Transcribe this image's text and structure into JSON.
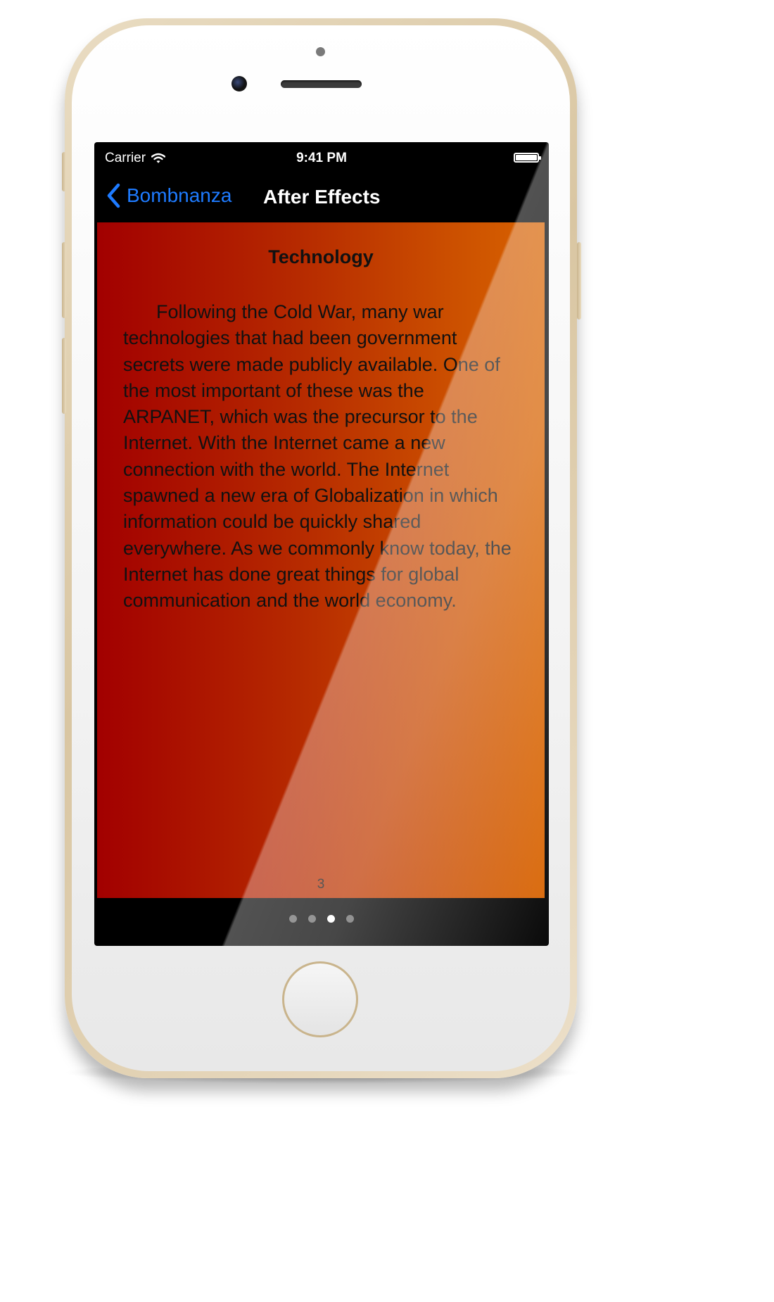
{
  "status_bar": {
    "carrier": "Carrier",
    "time": "9:41 PM",
    "wifi_icon": "wifi-icon",
    "battery_icon": "battery-icon"
  },
  "nav_bar": {
    "back_label": "Bombnanza",
    "back_icon": "chevron-left-icon",
    "title": "After Effects"
  },
  "page": {
    "heading": "Technology",
    "body": "Following the Cold War, many war technologies that had been government secrets were made publicly available. One of the most important of these was the ARPANET, which was the precursor to the Internet. With the Internet came a new connection with the world. The Internet spawned a new era of Globalization in which information could be quickly shared everywhere. As we commonly know today, the Internet has done great things for global communication and the world economy.",
    "page_number": "3"
  },
  "page_control": {
    "total_pages": 4,
    "current_index": 2
  },
  "colors": {
    "accent": "#1e7bff",
    "gradient_start": "#a20000",
    "gradient_end": "#d86300"
  }
}
